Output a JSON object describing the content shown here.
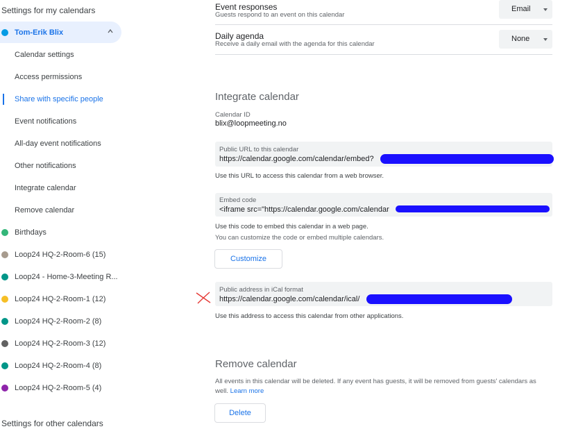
{
  "sidebar": {
    "header_my": "Settings for my calendars",
    "header_other": "Settings for other calendars",
    "active_calendar": {
      "name": "Tom-Erik Blix",
      "color": "#039be5"
    },
    "sub_items": [
      "Calendar settings",
      "Access permissions",
      "Share with specific people",
      "Event notifications",
      "All-day event notifications",
      "Other notifications",
      "Integrate calendar",
      "Remove calendar"
    ],
    "selected_sub_index": 2,
    "calendars": [
      {
        "name": "Birthdays",
        "color": "#33b679"
      },
      {
        "name": "Loop24 HQ-2-Room-6 (15)",
        "color": "#a79b8e"
      },
      {
        "name": "Loop24 - Home-3-Meeting R...",
        "color": "#009688"
      },
      {
        "name": "Loop24 HQ-2-Room-1 (12)",
        "color": "#f6bf26"
      },
      {
        "name": "Loop24 HQ-2-Room-2 (8)",
        "color": "#009688"
      },
      {
        "name": "Loop24 HQ-2-Room-3 (12)",
        "color": "#616161"
      },
      {
        "name": "Loop24 HQ-2-Room-4 (8)",
        "color": "#009688"
      },
      {
        "name": "Loop24 HQ-2-Room-5 (4)",
        "color": "#8e24aa"
      }
    ]
  },
  "notifications": {
    "event_responses": {
      "title": "Event responses",
      "subtitle": "Guests respond to an event on this calendar",
      "value": "Email"
    },
    "daily_agenda": {
      "title": "Daily agenda",
      "subtitle": "Receive a daily email with the agenda for this calendar",
      "value": "None"
    }
  },
  "integrate": {
    "title": "Integrate calendar",
    "calendar_id_label": "Calendar ID",
    "calendar_id": "blix@loopmeeting.no",
    "public_url_label": "Public URL to this calendar",
    "public_url": "https://calendar.google.com/calendar/embed?",
    "public_url_help": "Use this URL to access this calendar from a web browser.",
    "embed_label": "Embed code",
    "embed_code": "<iframe src=\"https://calendar.google.com/calendar",
    "embed_help1": "Use this code to embed this calendar in a web page.",
    "embed_help2": "You can customize the code or embed multiple calendars.",
    "customize_label": "Customize",
    "ical_label": "Public address in iCal format",
    "ical_url": "https://calendar.google.com/calendar/ical/",
    "ical_help": "Use this address to access this calendar from other applications."
  },
  "remove": {
    "title": "Remove calendar",
    "text": "All events in this calendar will be deleted. If any event has guests, it will be removed from guests' calendars as",
    "text2": "well.",
    "learn_more": "Learn more",
    "delete_label": "Delete"
  },
  "colors": {
    "accent": "#1a73e8",
    "redaction": "#1a10ff",
    "annotation": "#e53935"
  }
}
